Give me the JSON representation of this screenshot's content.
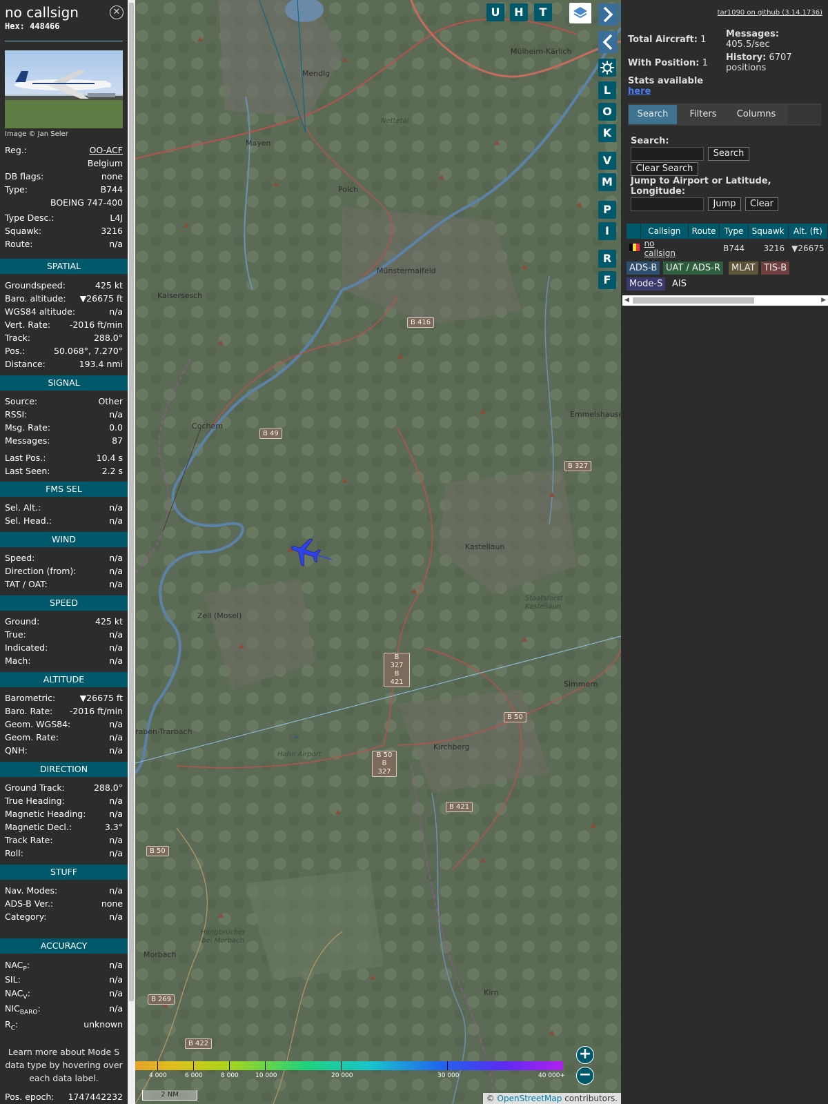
{
  "info": {
    "callsign": "no callsign",
    "hex_label": "Hex:",
    "hex": "448466",
    "close_glyph": "✕",
    "photo_credit": "Image © Jan Seler",
    "reg_label": "Reg.:",
    "reg": "OO-ACF",
    "country": "Belgium",
    "dbflags_label": "DB flags:",
    "dbflags": "none",
    "type_label": "Type:",
    "type": "B744",
    "type_full": "BOEING 747-400",
    "typedesc_label": "Type Desc.:",
    "typedesc": "L4J",
    "squawk_label": "Squawk:",
    "squawk": "3216",
    "route_label": "Route:",
    "route": "n/a"
  },
  "sections": {
    "spatial": "SPATIAL",
    "signal": "SIGNAL",
    "fms": "FMS SEL",
    "wind": "WIND",
    "speed": "SPEED",
    "altitude": "ALTITUDE",
    "direction": "DIRECTION",
    "stuff": "STUFF",
    "accuracy": "ACCURACY"
  },
  "spatial": {
    "gs_label": "Groundspeed:",
    "gs": "425 kt",
    "baro_label": "Baro. altitude:",
    "baro": "▼26675 ft",
    "wgs_label": "WGS84 altitude:",
    "wgs": "n/a",
    "vr_label": "Vert. Rate:",
    "vr": "-2016 ft/min",
    "track_label": "Track:",
    "track": "288.0°",
    "pos_label": "Pos.:",
    "pos": "50.068°, 7.270°",
    "dist_label": "Distance:",
    "dist": "193.4 nmi"
  },
  "signal": {
    "source_label": "Source:",
    "source": "Other",
    "rssi_label": "RSSI:",
    "rssi": "n/a",
    "msgrate_label": "Msg. Rate:",
    "msgrate": "0.0",
    "messages_label": "Messages:",
    "messages": "87",
    "lastpos_label": "Last Pos.:",
    "lastpos": "10.4 s",
    "lastseen_label": "Last Seen:",
    "lastseen": "2.2 s"
  },
  "fms": {
    "selalt_label": "Sel. Alt.:",
    "selalt": "n/a",
    "selhead_label": "Sel. Head.:",
    "selhead": "n/a"
  },
  "wind": {
    "speed_label": "Speed:",
    "speed": "n/a",
    "dir_label": "Direction (from):",
    "dir": "n/a",
    "tat_label": "TAT / OAT:",
    "tat": "n/a"
  },
  "speed": {
    "ground_label": "Ground:",
    "ground": "425 kt",
    "true_label": "True:",
    "true": "n/a",
    "ind_label": "Indicated:",
    "ind": "n/a",
    "mach_label": "Mach:",
    "mach": "n/a"
  },
  "altitude": {
    "baro_label": "Barometric:",
    "baro": "▼26675 ft",
    "rate_label": "Baro. Rate:",
    "rate": "-2016 ft/min",
    "geom_label": "Geom. WGS84:",
    "geom": "n/a",
    "grate_label": "Geom. Rate:",
    "grate": "n/a",
    "qnh_label": "QNH:",
    "qnh": "n/a"
  },
  "direction": {
    "gt_label": "Ground Track:",
    "gt": "288.0°",
    "th_label": "True Heading:",
    "th": "n/a",
    "mh_label": "Magnetic Heading:",
    "mh": "n/a",
    "md_label": "Magnetic Decl.:",
    "md": "3.3°",
    "tr_label": "Track Rate:",
    "tr": "n/a",
    "roll_label": "Roll:",
    "roll": "n/a"
  },
  "stuff": {
    "nav_label": "Nav. Modes:",
    "nav": "n/a",
    "adsb_label": "ADS-B Ver.:",
    "adsb": "none",
    "cat_label": "Category:",
    "cat": "n/a"
  },
  "accuracy": {
    "nacp_main": "NAC",
    "nacp_sub": "P",
    "nacp_colon": ":",
    "nacp": "n/a",
    "sil_label": "SIL:",
    "sil": "n/a",
    "nacv_main": "NAC",
    "nacv_sub": "V",
    "nacv_colon": ":",
    "nacv": "n/a",
    "nic_main": "NIC",
    "nic_sub": "BARO",
    "nic_colon": ":",
    "nic": "n/a",
    "rc_main": "R",
    "rc_sub": "C",
    "rc_colon": ":",
    "rc": "unknown"
  },
  "learn_more": "Learn more about Mode S data type by hovering over each data label.",
  "pos_epoch_label": "Pos. epoch:",
  "pos_epoch": "1747442232",
  "map": {
    "buttons_top": [
      "U",
      "H",
      "T"
    ],
    "buttons_side": [
      "L",
      "O",
      "K",
      "V",
      "M",
      "P",
      "I",
      "R",
      "F"
    ],
    "towns": [
      {
        "name": "Mendig"
      },
      {
        "name": "Mayen"
      },
      {
        "name": "Polch"
      },
      {
        "name": "Mülheim-Kärlich"
      },
      {
        "name": "Kaisersesch"
      },
      {
        "name": "Münstermaifeld"
      },
      {
        "name": "Cochem"
      },
      {
        "name": "Emmelshause"
      },
      {
        "name": "Kastellaun"
      },
      {
        "name": "Zell (Mosel)"
      },
      {
        "name": "Simmern"
      },
      {
        "name": "raben-Trarbach"
      },
      {
        "name": "Kirchberg"
      },
      {
        "name": "Morbach"
      },
      {
        "name": "Kirn"
      },
      {
        "name": "Nettetal"
      },
      {
        "name": "Hahn Airport"
      },
      {
        "name": "Staatsforst Kastellaun"
      },
      {
        "name": "Hangbrücher bei Morbach"
      }
    ],
    "roads": [
      "B 416",
      "B 49",
      "B 327",
      "B 327 B 421",
      "B 50",
      "B 50 B 327",
      "B 421",
      "B 50",
      "B 269",
      "B 422"
    ],
    "zoom_in": "+",
    "zoom_out": "−",
    "scale": "2 NM",
    "attribution_prefix": "©",
    "attribution_link": "OpenStreetMap",
    "attribution_suffix": "contributors."
  },
  "altitude_legend": {
    "labels": [
      "4 000",
      "6 000",
      "8 000",
      "10 000",
      "20 000",
      "30 000",
      "40 000+"
    ]
  },
  "sidebar": {
    "github": "tar1090 on github (3.14.1736)",
    "total_label": "Total Aircraft:",
    "total": "1",
    "withpos_label": "With Position:",
    "withpos": "1",
    "messages_label": "Messages:",
    "messages_rate": "405.5/sec",
    "history_label": "History:",
    "history": "6707",
    "history_unit": "positions",
    "stats_text": "Stats available",
    "stats_link": "here",
    "tabs": [
      "Search",
      "Filters",
      "Columns"
    ],
    "search_label": "Search:",
    "search_btn": "Search",
    "clear_search_btn": "Clear Search",
    "jump_label": "Jump to Airport or Latitude, Longitude:",
    "jump_btn": "Jump",
    "clear_btn": "Clear",
    "table": {
      "columns": [
        "Callsign",
        "Route",
        "Type",
        "Squawk",
        "Alt. (ft)"
      ],
      "rows": [
        {
          "callsign": "no callsign",
          "route": "",
          "type": "B744",
          "squawk": "3216",
          "alt": "▼26675"
        }
      ]
    },
    "sources": [
      "ADS-B",
      "UAT / ADS-R",
      "MLAT",
      "TIS-B",
      "Mode-S",
      "AIS"
    ]
  },
  "colors": {
    "section_bg": "#00596b",
    "panel_bg": "#2c2c2c",
    "aircraft": "#2f43e8"
  }
}
